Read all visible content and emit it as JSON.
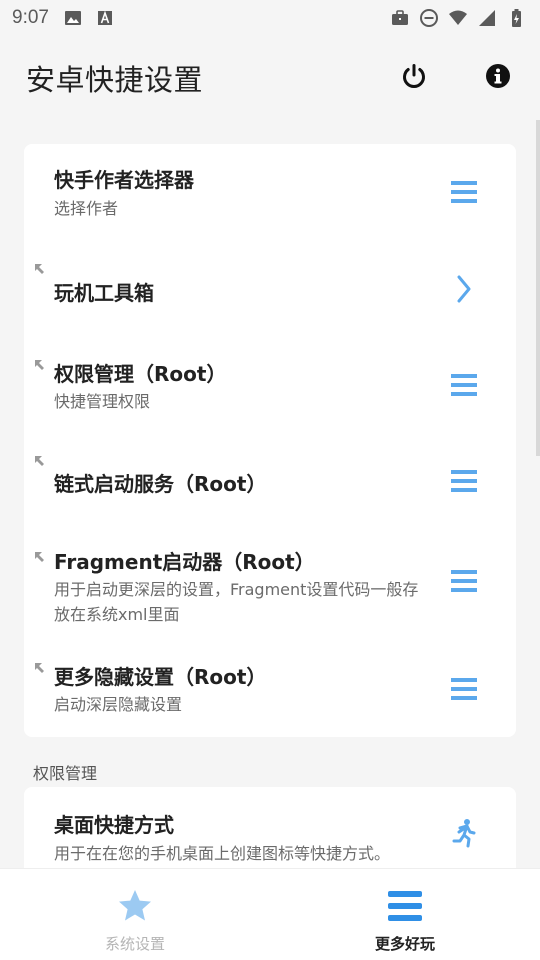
{
  "status_bar": {
    "time": "9:07",
    "left_icons": [
      "image-icon",
      "font-a-icon"
    ],
    "right_icons": [
      "briefcase-icon",
      "dnd-icon",
      "wifi-icon",
      "signal-icon",
      "battery-charging-icon"
    ]
  },
  "header": {
    "title": "安卓快捷设置",
    "actions": [
      "power-icon",
      "info-icon"
    ]
  },
  "colors": {
    "accent": "#5ba8ec",
    "star": "#9ccaf2",
    "card": "#ffffff",
    "background": "#f5f5f5"
  },
  "card1": {
    "items": [
      {
        "title": "快手作者选择器",
        "desc": "选择作者",
        "trail_icon": "menu-icon"
      },
      {
        "title": "玩机工具箱",
        "trail_icon": "chevron-right-icon"
      },
      {
        "title": "权限管理（Root）",
        "desc": "快捷管理权限",
        "trail_icon": "menu-icon"
      },
      {
        "title": "链式启动服务（Root）",
        "trail_icon": "menu-icon"
      },
      {
        "title": "Fragment启动器（Root）",
        "desc_line1": "用于启动更深层的设置，Fragment设置代码一般存",
        "desc_line2": "放在系统xml里面",
        "trail_icon": "menu-icon"
      },
      {
        "title": "更多隐藏设置（Root）",
        "desc": "启动深层隐藏设置",
        "trail_icon": "menu-icon"
      }
    ]
  },
  "section2": {
    "label": "权限管理",
    "items": [
      {
        "title": "桌面快捷方式",
        "desc": "用于在在您的手机桌面上创建图标等快捷方式。",
        "trail_icon": "running-man-icon"
      }
    ]
  },
  "bottom_nav": {
    "tabs": [
      {
        "label": "系统设置",
        "icon": "star-icon",
        "active": false
      },
      {
        "label": "更多好玩",
        "icon": "menu-icon",
        "active": true
      }
    ]
  }
}
